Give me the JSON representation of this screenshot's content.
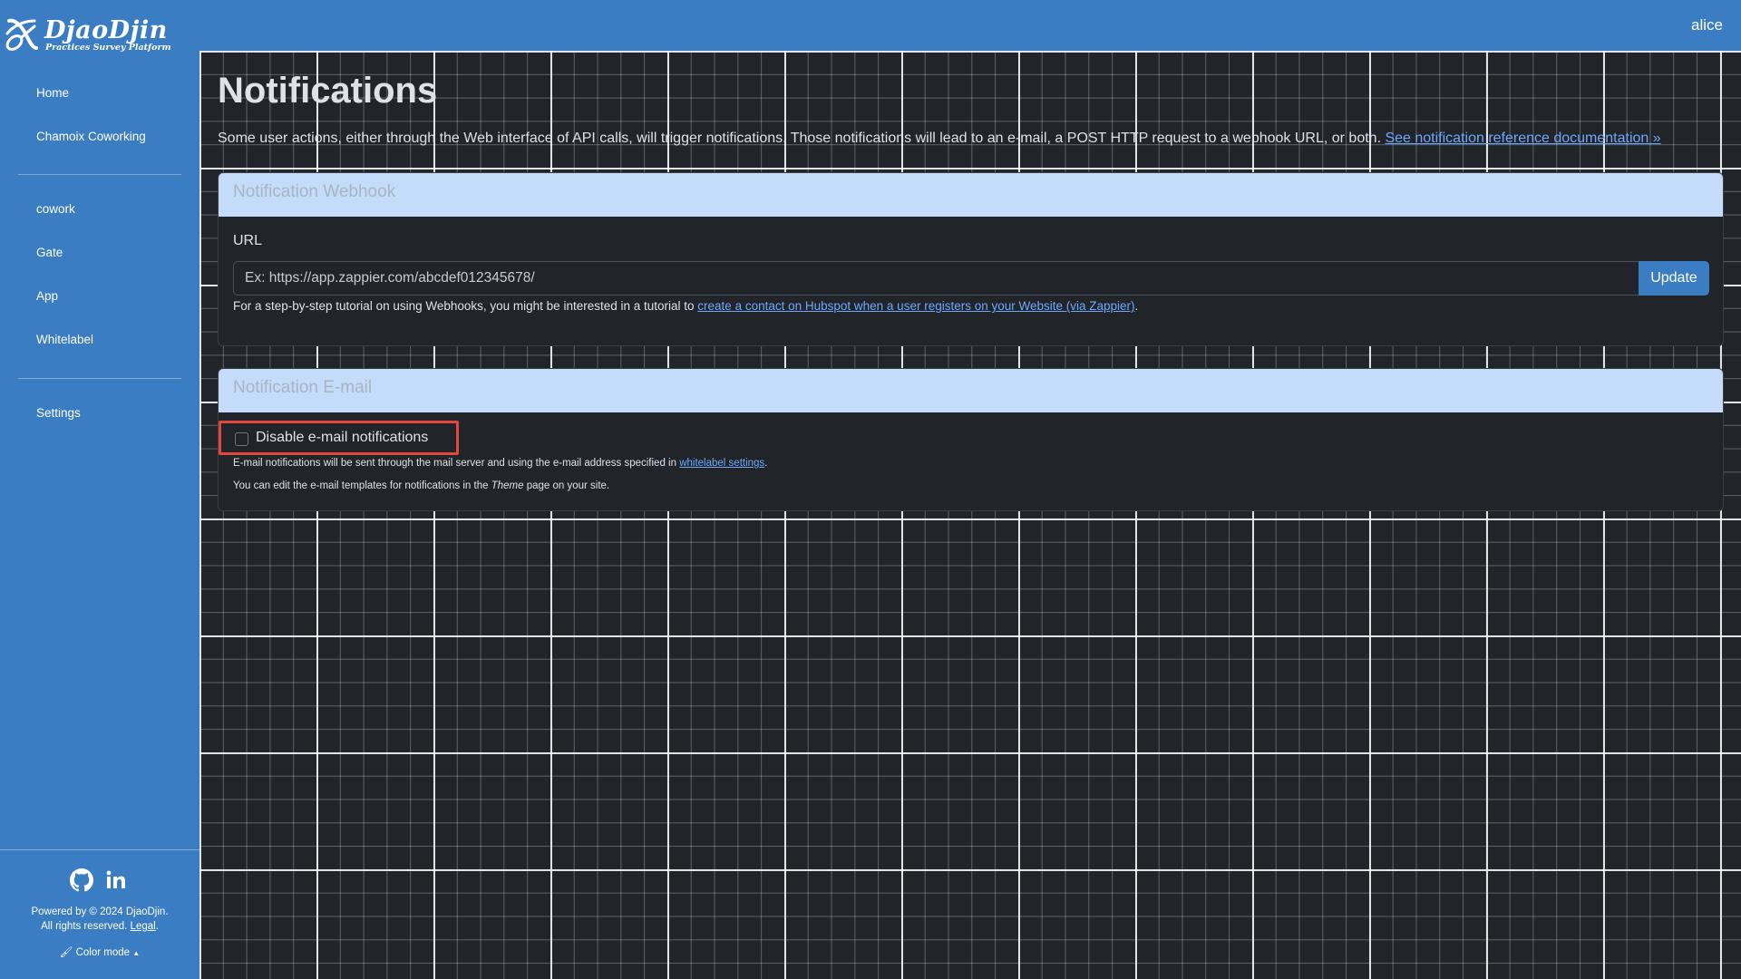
{
  "brand": {
    "name": "DjaoDjin",
    "tagline": "Practices Survey Platform"
  },
  "user": {
    "name": "alice"
  },
  "sidebar": {
    "items": [
      {
        "label": "Home"
      },
      {
        "label": "Chamoix Coworking"
      },
      {
        "label": "cowork"
      },
      {
        "label": "Gate"
      },
      {
        "label": "App"
      },
      {
        "label": "Whitelabel"
      },
      {
        "label": "Settings"
      }
    ],
    "footer": {
      "powered": "Powered by © 2024 DjaoDjin.",
      "rights": "All rights reserved.",
      "legal_link": "Legal",
      "color_mode": "Color mode",
      "icons": [
        "github-icon",
        "linkedin-icon",
        "brush-icon",
        "caret-up-icon"
      ]
    }
  },
  "page": {
    "title": "Notifications",
    "intro": "Some user actions, either through the Web interface of API calls, will trigger notifications. Those notifications will lead to an e-mail, a POST HTTP request to a webhook URL, or both.",
    "intro_link": "See notification reference documentation »"
  },
  "webhook": {
    "header": "Notification Webhook",
    "url_label": "URL",
    "url_placeholder": "Ex: https://app.zappier.com/abcdef012345678/",
    "url_value": "",
    "update_button": "Update",
    "help_prefix": "For a step-by-step tutorial on using Webhooks, you might be interested in a tutorial to",
    "help_link": "create a contact on Hubspot when a user registers on your Website (via Zappier)",
    "help_suffix": "."
  },
  "email": {
    "header": "Notification E-mail",
    "checkbox_label": "Disable e-mail notifications",
    "checkbox_checked": false,
    "note1_prefix": "E-mail notifications will be sent through the mail server and using the e-mail address specified in",
    "note1_link": "whitelabel settings",
    "note1_suffix": ".",
    "note2_prefix": "You can edit the e-mail templates for notifications in the",
    "note2_em": "Theme",
    "note2_suffix": "page on your site."
  },
  "colors": {
    "brand_blue": "#3b7dc2",
    "card_header": "#c4dbf9",
    "highlight": "#e3463b",
    "link": "#6ea8fe",
    "background": "#212529"
  }
}
